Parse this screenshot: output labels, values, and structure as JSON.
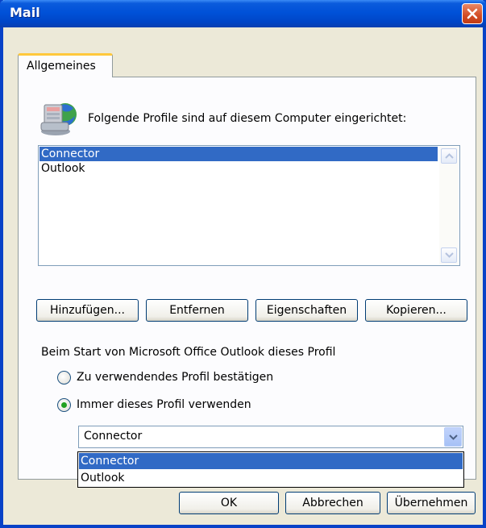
{
  "window": {
    "title": "Mail"
  },
  "tabs": [
    {
      "label": "Allgemeines"
    }
  ],
  "general": {
    "header_text": "Folgende Profile sind auf diesem Computer eingerichtet:",
    "profiles": [
      "Connector",
      "Outlook"
    ],
    "selected_profile": "Connector",
    "buttons": {
      "add": "Hinzufügen...",
      "remove": "Entfernen",
      "properties": "Eigenschaften",
      "copy": "Kopieren..."
    },
    "startup_label": "Beim Start von Microsoft Office Outlook dieses Profil",
    "radio_confirm": "Zu verwendendes Profil bestätigen",
    "radio_always": "Immer dieses Profil verwenden",
    "selected_radio": "always",
    "combo_value": "Connector",
    "dropdown_options": [
      "Connector",
      "Outlook"
    ],
    "dropdown_highlighted": "Connector"
  },
  "footer": {
    "ok": "OK",
    "cancel": "Abbrechen",
    "apply": "Übernehmen"
  },
  "colors": {
    "title_bar": "#0054e3",
    "selection": "#316ac5",
    "close_button": "#d24c24",
    "tab_highlight": "#ffc83c"
  },
  "icons": {
    "profile": "mail-profile-icon",
    "close": "close-icon",
    "scroll_up": "chevron-up-icon",
    "scroll_down": "chevron-down-icon",
    "combo": "chevron-down-icon"
  }
}
